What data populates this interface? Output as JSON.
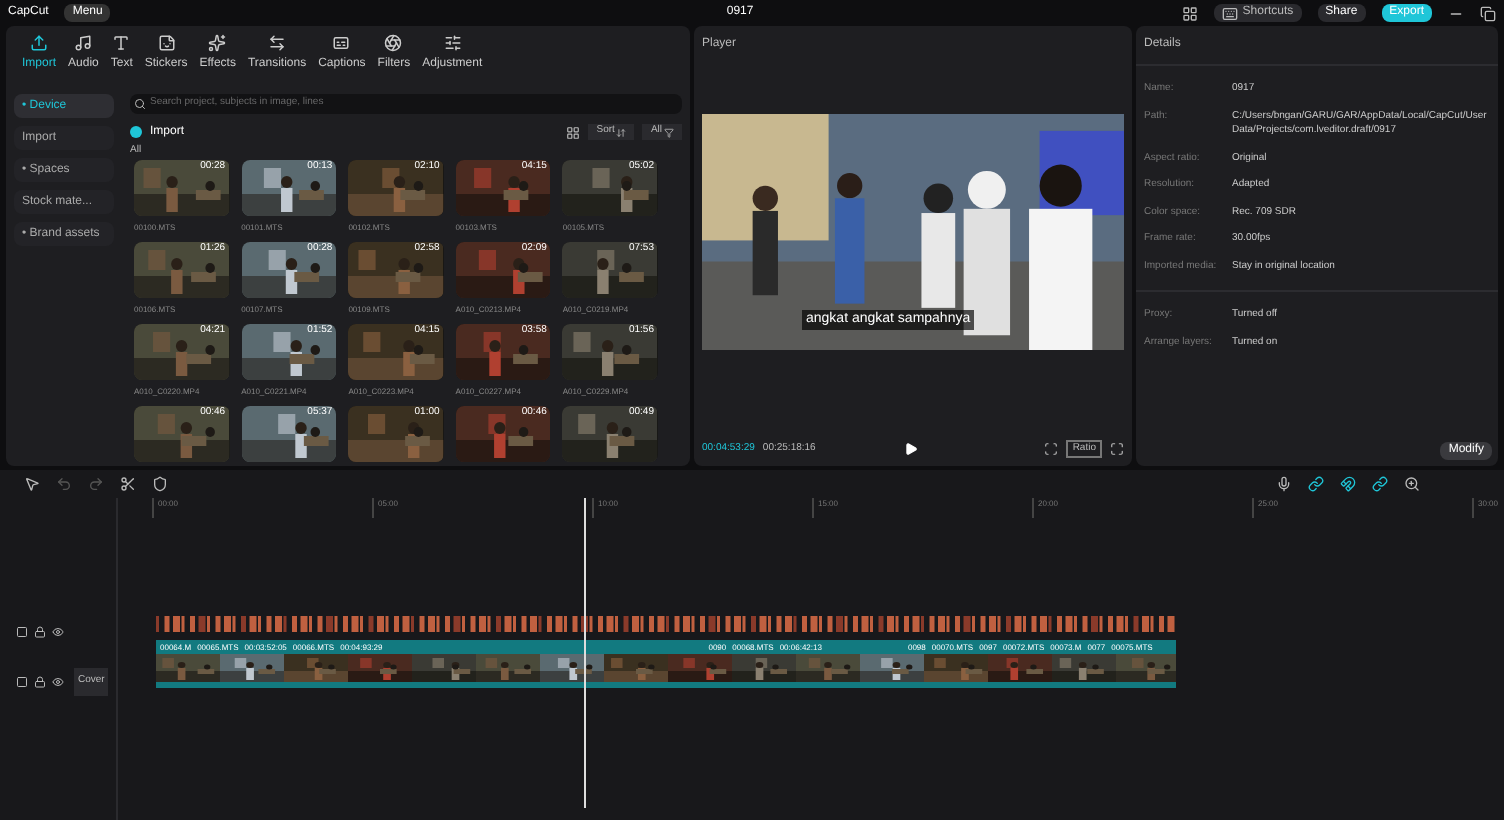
{
  "app": {
    "logo": "CapCut",
    "menu": "Menu",
    "project_title": "0917",
    "shortcuts": "Shortcuts",
    "share": "Share",
    "export": "Export"
  },
  "toolbar_tabs": [
    {
      "label": "Import",
      "selected": true
    },
    {
      "label": "Audio",
      "selected": false
    },
    {
      "label": "Text",
      "selected": false
    },
    {
      "label": "Stickers",
      "selected": false
    },
    {
      "label": "Effects",
      "selected": false
    },
    {
      "label": "Transitions",
      "selected": false
    },
    {
      "label": "Captions",
      "selected": false
    },
    {
      "label": "Filters",
      "selected": false
    },
    {
      "label": "Adjustment",
      "selected": false
    }
  ],
  "sidebar": [
    {
      "label": "• Device",
      "selected": true
    },
    {
      "label": "Import",
      "selected": false
    },
    {
      "label": "• Spaces",
      "selected": false
    },
    {
      "label": "Stock mate...",
      "selected": false
    },
    {
      "label": "• Brand assets",
      "selected": false
    }
  ],
  "media": {
    "search_placeholder": "Search project, subjects in image, lines",
    "import": "Import",
    "sort": "Sort",
    "filter": "All",
    "section": "All",
    "items": [
      {
        "duration": "00:28",
        "name": "00100.MTS"
      },
      {
        "duration": "00:13",
        "name": "00101.MTS"
      },
      {
        "duration": "02:10",
        "name": "00102.MTS"
      },
      {
        "duration": "04:15",
        "name": "00103.MTS"
      },
      {
        "duration": "05:02",
        "name": "00105.MTS"
      },
      {
        "duration": "01:26",
        "name": "00106.MTS"
      },
      {
        "duration": "00:28",
        "name": "00107.MTS"
      },
      {
        "duration": "02:58",
        "name": "00109.MTS"
      },
      {
        "duration": "02:09",
        "name": "A010_C0213.MP4"
      },
      {
        "duration": "07:53",
        "name": "A010_C0219.MP4"
      },
      {
        "duration": "04:21",
        "name": "A010_C0220.MP4"
      },
      {
        "duration": "01:52",
        "name": "A010_C0221.MP4"
      },
      {
        "duration": "04:15",
        "name": "A010_C0223.MP4"
      },
      {
        "duration": "03:58",
        "name": "A010_C0227.MP4"
      },
      {
        "duration": "01:56",
        "name": "A010_C0229.MP4"
      },
      {
        "duration": "00:46"
      },
      {
        "duration": "05:37"
      },
      {
        "duration": "01:00"
      },
      {
        "duration": "00:46"
      },
      {
        "duration": "00:49"
      }
    ]
  },
  "player": {
    "title": "Player",
    "subtitle": "angkat angkat sampahnya",
    "current_time": "00:04:53:29",
    "total_time": "00:25:18:16",
    "ratio": "Ratio"
  },
  "details": {
    "title": "Details",
    "fields": [
      {
        "label": "Name:",
        "value": "0917"
      },
      {
        "label": "Path:",
        "value": "C:/Users/bngan/GARU/GAR/AppData/Local/CapCut/User Data/Projects/com.lveditor.draft/0917"
      },
      {
        "label": "Aspect ratio:",
        "value": "Original"
      },
      {
        "label": "Resolution:",
        "value": "Adapted"
      },
      {
        "label": "Color space:",
        "value": "Rec. 709 SDR"
      },
      {
        "label": "Frame rate:",
        "value": "30.00fps"
      },
      {
        "label": "Imported media:",
        "value": "Stay in original location"
      }
    ],
    "settings": [
      {
        "label": "Proxy:",
        "value": "Turned off"
      },
      {
        "label": "Arrange layers:",
        "value": "Turned on"
      }
    ],
    "modify": "Modify"
  },
  "timeline": {
    "ruler": [
      "00:00",
      "05:00",
      "10:00",
      "15:00",
      "20:00",
      "25:00",
      "30:00"
    ],
    "cover": "Cover",
    "clips": [
      "00064.M",
      "00065.MTS",
      "00:03:52:05",
      "00066.MTS",
      "00:04:93:29",
      "0090",
      "00068.MTS",
      "00:06:42:13",
      "0098",
      "00070.MTS",
      "0097",
      "00072.MTS",
      "00073.M",
      "0077",
      "00075.MTS"
    ]
  }
}
